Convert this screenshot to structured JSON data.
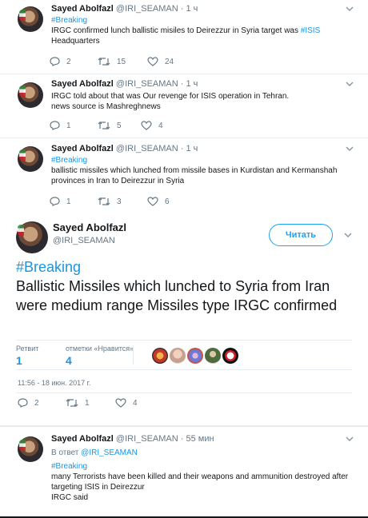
{
  "tweets": [
    {
      "name": "Sayed Abolfazl",
      "handle": "@IRI_SEAMAN",
      "dot": "·",
      "time": "1 ч",
      "tag": "#Breaking",
      "text_before": "IRGC confirmed lunch ballistic misiles to Deirezzur in Syria target was ",
      "inline_tag": "#ISIS",
      "text_after": " Headquarters",
      "replies": "2",
      "retweets": "15",
      "likes": "24"
    },
    {
      "name": "Sayed Abolfazl",
      "handle": "@IRI_SEAMAN",
      "dot": "·",
      "time": "1 ч",
      "line1": "IRGC told about that was Our revenge for ISIS operation in Tehran.",
      "line2": "news source is Mashreghnews",
      "replies": "1",
      "retweets": "5",
      "likes": "4"
    },
    {
      "name": "Sayed Abolfazl",
      "handle": "@IRI_SEAMAN",
      "dot": "·",
      "time": "1 ч",
      "tag": "#Breaking",
      "text": "ballistic missiles which lunched from missile bases in  Kurdistan and Kermanshah provinces in Iran to Deirezzur in Syria",
      "replies": "1",
      "retweets": "3",
      "likes": "6"
    }
  ],
  "expanded": {
    "name": "Sayed Abolfazl",
    "handle": "@IRI_SEAMAN",
    "follow_label": "Читать",
    "tag": "#Breaking",
    "text": "Ballistic Missiles which lunched to Syria from Iran were medium range Missiles type IRGC confirmed",
    "retweets_label": "Ретвит",
    "retweets_count": "1",
    "likes_label": "отметки «Нравится»",
    "likes_count": "4",
    "timestamp": "11:56 - 18 июн. 2017 г.",
    "replies": "2",
    "retweets": "1",
    "likes": "4"
  },
  "reply": {
    "name": "Sayed Abolfazl",
    "handle": "@IRI_SEAMAN",
    "dot": "·",
    "time": "55 мин",
    "reply_prefix": "В ответ",
    "reply_to": "@IRI_SEAMAN",
    "tag": "#Breaking",
    "text": "many Terrorists have been killed and their weapons and ammunition destroyed after targeting ISIS in Deirezzur",
    "text2": "IRGC said"
  },
  "colors": {
    "link": "#1b95e0",
    "muted": "#657786",
    "follow": "#1da1f2"
  },
  "icons": [
    "chevron-down-icon",
    "reply-icon",
    "retweet-icon",
    "heart-icon"
  ]
}
